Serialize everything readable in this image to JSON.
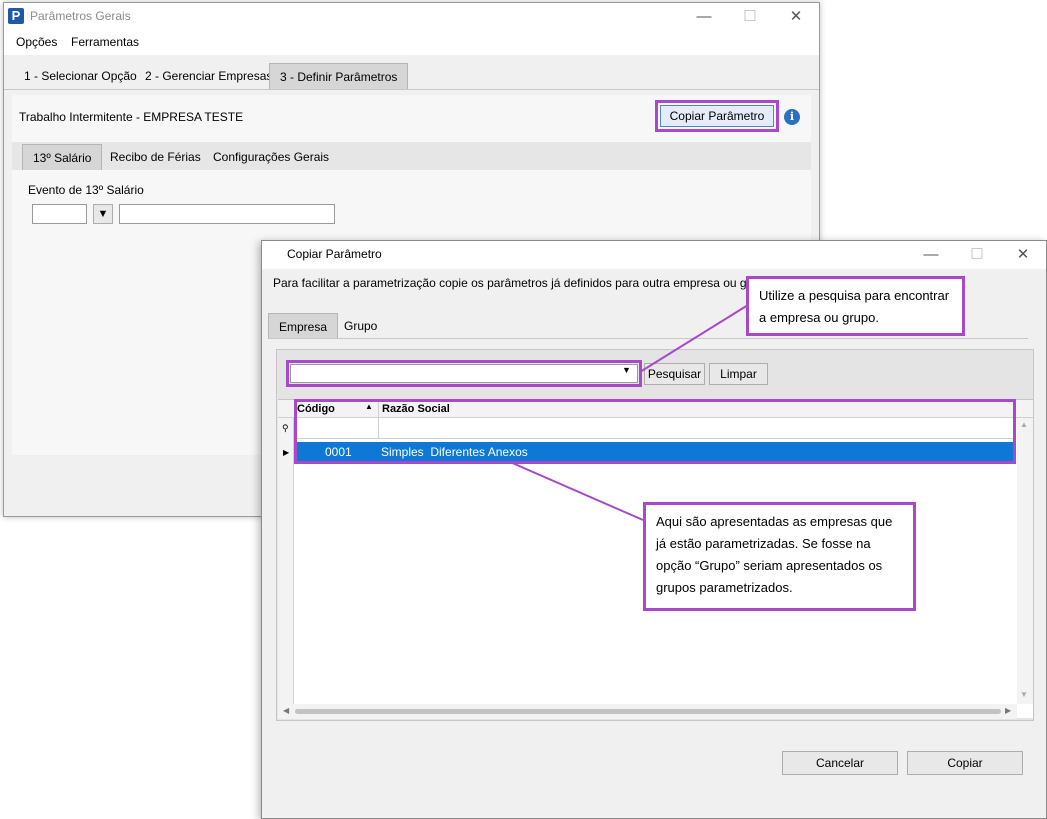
{
  "main_window": {
    "title": "Parâmetros Gerais",
    "logo_letter": "P",
    "menu": [
      "Opções",
      "Ferramentas"
    ],
    "tabs": [
      "1 - Selecionar Opção",
      "2 - Gerenciar Empresas",
      "3 - Definir Parâmetros"
    ],
    "active_tab": "3 - Definir Parâmetros",
    "context_label": "Trabalho Intermitente - EMPRESA TESTE",
    "copy_button": "Copiar Parâmetro",
    "sub_tabs": [
      "13º Salário",
      "Recibo de Férias",
      "Configurações Gerais"
    ],
    "active_sub_tab": "13º Salário",
    "field_label": "Evento de 13º Salário",
    "field_code_value": "",
    "field_desc_value": ""
  },
  "dialog": {
    "title": "Copiar Parâmetro",
    "description": "Para facilitar a parametrização copie os parâmetros já definidos para outra empresa ou grupo",
    "tabs": [
      "Empresa",
      "Grupo"
    ],
    "active_tab": "Empresa",
    "search_value": "",
    "search_button": "Pesquisar",
    "clear_button": "Limpar",
    "grid": {
      "columns": [
        "Código",
        "Razão Social"
      ],
      "rows": [
        {
          "codigo": "0001",
          "razao_social": "Simples  Diferentes Anexos"
        }
      ]
    },
    "cancel_button": "Cancelar",
    "copy_button": "Copiar"
  },
  "callouts": {
    "search_hint": "Utilize a pesquisa para encontrar a empresa ou grupo.",
    "grid_hint": "Aqui são apresentadas as empresas que já estão parametrizadas. Se fosse na opção “Grupo” seriam apresentados os grupos parametrizados."
  },
  "colors": {
    "highlight": "#a64ac9",
    "selection": "#0e78d4",
    "brand": "#1e5aa8"
  }
}
